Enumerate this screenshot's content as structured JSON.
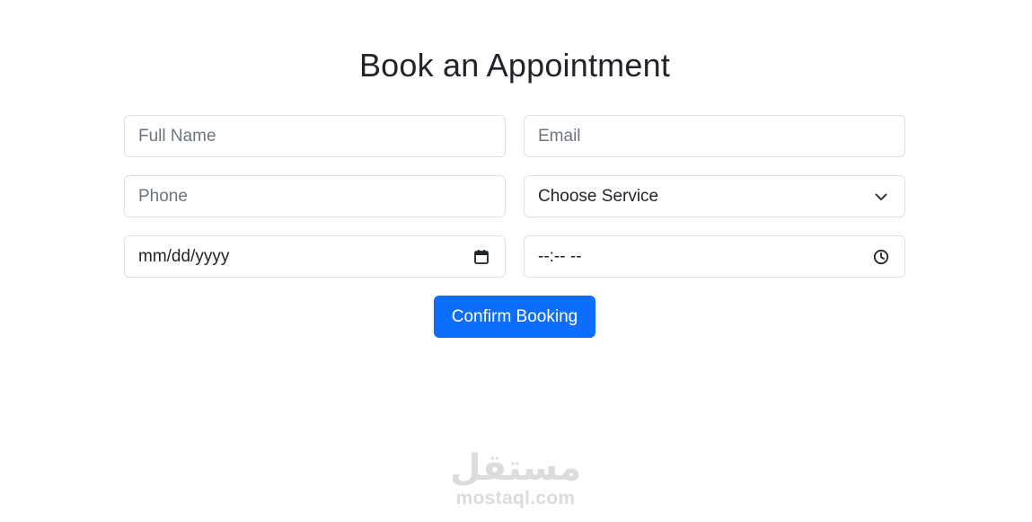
{
  "form": {
    "title": "Book an Appointment",
    "full_name": {
      "placeholder": "Full Name"
    },
    "email": {
      "placeholder": "Email"
    },
    "phone": {
      "placeholder": "Phone"
    },
    "service": {
      "selected": "Choose Service",
      "icon": "chevron-down-icon"
    },
    "date": {
      "placeholder": "mm/dd/yyyy",
      "icon": "calendar-icon"
    },
    "time": {
      "placeholder": "--:-- --",
      "icon": "clock-icon"
    },
    "submit_label": "Confirm Booking"
  },
  "watermark": {
    "arabic": "مستقل",
    "latin": "mostaql.com"
  },
  "colors": {
    "primary": "#0d6efd",
    "border": "#dee2e6",
    "placeholder": "#6c757d",
    "text": "#212529",
    "watermark": "#dcdcdc"
  }
}
